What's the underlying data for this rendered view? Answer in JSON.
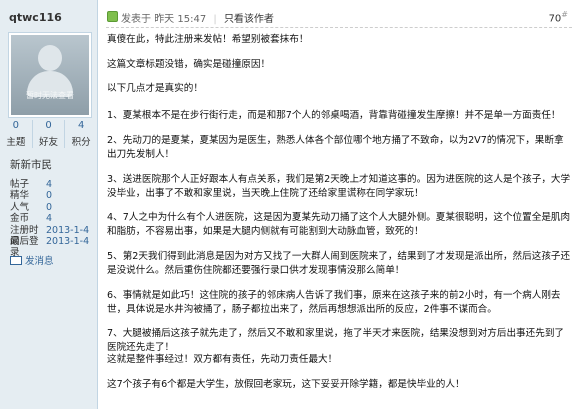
{
  "user": {
    "name": "qtwc116",
    "avatar_caption": "暂时无法查看",
    "stats": [
      {
        "value": "0",
        "label": "主题"
      },
      {
        "value": "0",
        "label": "好友"
      },
      {
        "value": "4",
        "label": "积分"
      }
    ],
    "group": "新新市民",
    "info": [
      {
        "key": "帖子",
        "value": "4"
      },
      {
        "key": "精华",
        "value": "0"
      },
      {
        "key": "人气",
        "value": "0"
      },
      {
        "key": "金币",
        "value": "4"
      },
      {
        "key": "注册时间",
        "value": "2013-1-4"
      },
      {
        "key": "最后登录",
        "value": "2013-1-4"
      }
    ],
    "pm_label": "发消息"
  },
  "post": {
    "posted_prefix": "发表于",
    "posted_time": "昨天 15:47",
    "separator": "|",
    "only_author": "只看该作者",
    "floor": "70",
    "floor_suffix": "#",
    "paragraphs": [
      "真傻在此，特此注册来发帖！希望别被套抹布！",
      "这篇文章标题没错，确实是碰撞原因！",
      "以下几点才是真实的！",
      "1、夏某根本不是在步行街行走，而是和那7个人的邻桌喝酒，背靠背碰撞发生摩擦！并不是单一方面责任！",
      "2、先动刀的是夏某，夏某因为是医生，熟悉人体各个部位哪个地方捅了不致命，以为2V7的情况下，果断拿出刀先发制人！",
      "3、送进医院那个人正好跟本人有点关系，我们是第2天晚上才知道这事的。因为进医院的这人是个孩子，大学没毕业，出事了不敢和家里说，当天晚上住院了还给家里谎称在同学家玩！",
      "4、7人之中为什么有个人进医院，这是因为夏某先动刀捅了这个人大腿外侧。夏某很聪明，这个位置全是肌肉和脂肪，不容易出事，如果是大腿内侧就有可能割到大动脉血管，致死的！",
      "5、第2天我们得到此消息是因为对方又找了一大群人闹到医院来了，结果到了才发现是派出所，然后这孩子还是没说什么。然后重伤住院都还要强行录口供才发现事情没那么简单！",
      "6、事情就是如此巧！这住院的孩子的邻床病人告诉了我们事，原来在这孩子来的前2小时，有一个病人刚去世，具体说是水井沟被捅了，肠子都拉出来了，然后再想想派出所的反应，2件事不谋而合。",
      "7、大腿被捅后这孩子就先走了，然后又不敢和家里说，拖了半天才来医院，结果没想到对方后出事还先到了医院还先走了！",
      "这就是整件事经过！双方都有责任，先动刀责任最大！",
      "这7个孩子有6个都是大学生，放假回老家玩，这下妥妥开除学籍，都是快毕业的人！"
    ]
  },
  "colors": {
    "side_bg": "#e5edf2",
    "border": "#c2d5e3",
    "link": "#336699",
    "online": "#7fbf4d"
  }
}
